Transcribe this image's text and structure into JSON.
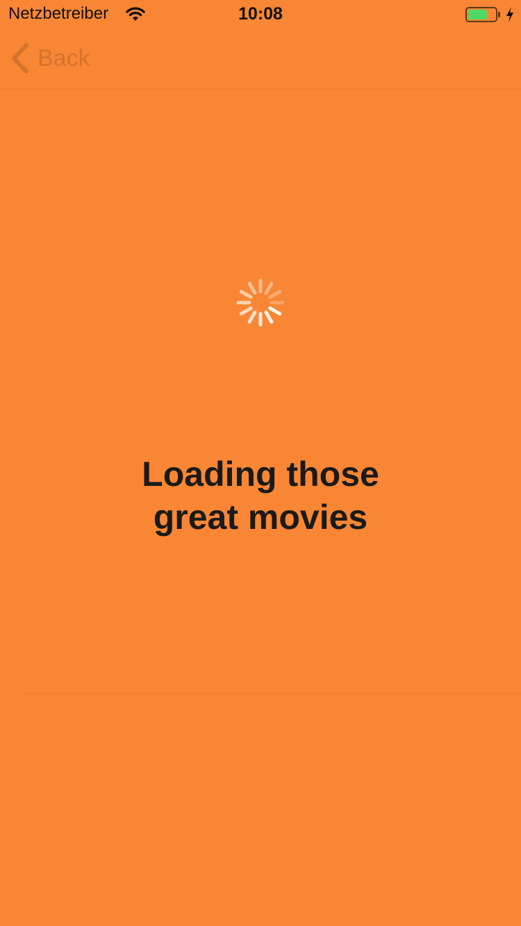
{
  "status_bar": {
    "carrier": "Netzbetreiber",
    "time": "10:08",
    "wifi_icon": "wifi-icon",
    "battery_icon": "battery-charging-icon",
    "battery_fill_fraction": 0.7
  },
  "nav": {
    "back_label": "Back",
    "back_icon": "chevron-left-icon"
  },
  "main": {
    "loading_line_1": "Loading those",
    "loading_line_2": "great movies",
    "spinner_icon": "activity-spinner-icon"
  },
  "colors": {
    "background": "#f88634",
    "text": "#1a1a1a",
    "battery_green": "#4cd964"
  }
}
